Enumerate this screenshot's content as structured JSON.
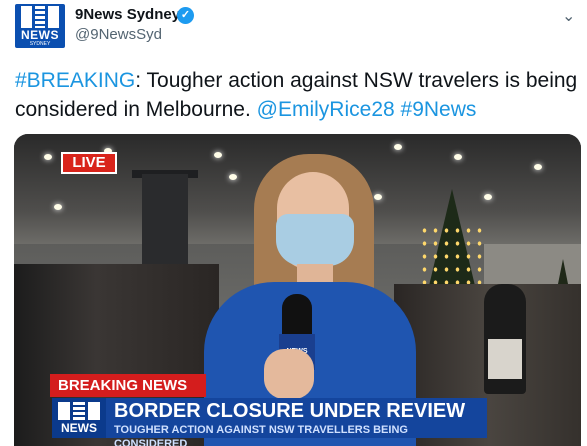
{
  "account": {
    "display_name": "9News Sydney",
    "handle": "@9NewsSyd",
    "avatar_logo_text": "NEWS",
    "avatar_logo_sub": "SYDNEY",
    "verified_icon": "verified-badge-icon"
  },
  "tweet": {
    "hashtag_breaking": "#BREAKING",
    "body": ": Tougher action against NSW travelers is being considered in Melbourne. ",
    "mention": "@EmilyRice28",
    "hashtag_9news": "#9News"
  },
  "media": {
    "live_label": "LIVE",
    "breaking_label": "BREAKING NEWS",
    "logo_text": "NEWS",
    "mic_flag_text": "NEWS",
    "headline": "BORDER CLOSURE UNDER REVIEW",
    "subheadline": "TOUGHER ACTION AGAINST NSW TRAVELLERS BEING CONSIDERED"
  },
  "colors": {
    "link": "#1b95e0",
    "brand_blue": "#14459d",
    "breaking_red": "#d41d1d"
  }
}
